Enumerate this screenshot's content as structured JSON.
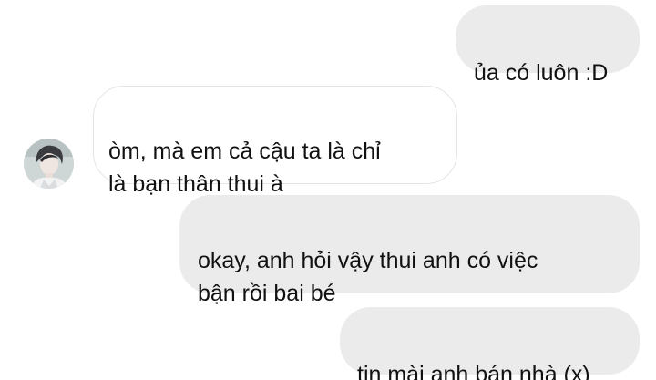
{
  "messages": [
    {
      "id": "m1",
      "sender": "me",
      "text": "ủa có luôn :D"
    },
    {
      "id": "m2",
      "sender": "other",
      "text": "òm, mà em cả cậu ta là chỉ\nlà bạn thân thui à"
    },
    {
      "id": "m3",
      "sender": "me",
      "text": "okay, anh hỏi vậy thui anh có việc\nbận rồi bai bé"
    },
    {
      "id": "m4",
      "sender": "me",
      "text": "tin mài anh bán nhà (x)"
    }
  ],
  "contact": {
    "avatar_icon": "contact-avatar-photo"
  },
  "colors": {
    "outgoing_bubble": "#ebebeb",
    "incoming_bubble": "#ffffff",
    "incoming_border": "#e4e4e4",
    "text": "#111111"
  }
}
